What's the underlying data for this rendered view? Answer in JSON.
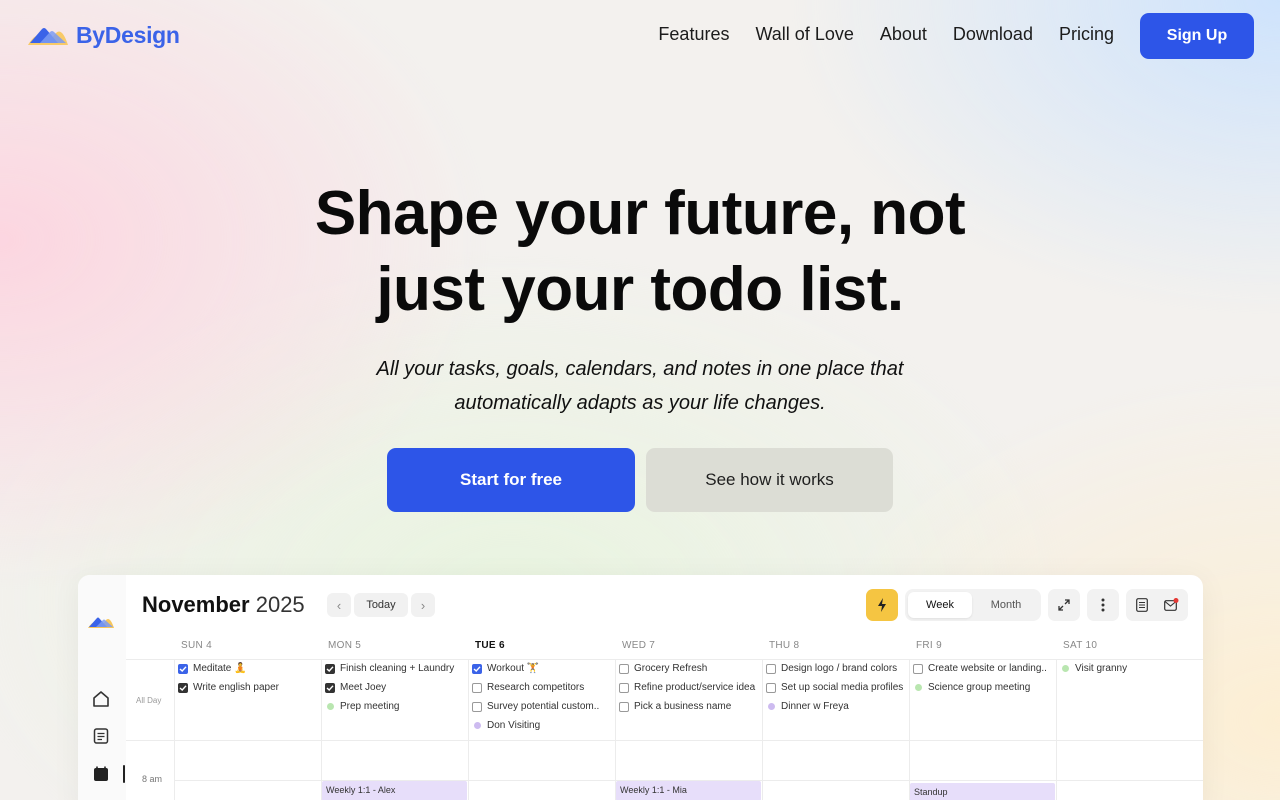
{
  "brand": {
    "name": "ByDesign",
    "color": "#3b63e8"
  },
  "nav": {
    "links": [
      "Features",
      "Wall of Love",
      "About",
      "Download",
      "Pricing"
    ],
    "signup": "Sign Up"
  },
  "hero": {
    "title_line1": "Shape your future, not",
    "title_line2": "just your todo list.",
    "subtitle_line1": "All your tasks, goals, calendars, and notes in one place that",
    "subtitle_line2": "automatically adapts as your life changes.",
    "cta_primary": "Start for free",
    "cta_secondary": "See how it works"
  },
  "app": {
    "month": "November",
    "year": "2025",
    "today_btn": "Today",
    "view_week": "Week",
    "view_month": "Month",
    "allday_label": "All Day",
    "time_label": "8 am",
    "days": [
      {
        "label": "SUN 4",
        "today": false
      },
      {
        "label": "MON 5",
        "today": false
      },
      {
        "label": "TUE 6",
        "today": true
      },
      {
        "label": "WED 7",
        "today": false
      },
      {
        "label": "THU 8",
        "today": false
      },
      {
        "label": "FRI 9",
        "today": false
      },
      {
        "label": "SAT 10",
        "today": false
      }
    ],
    "tasks": [
      [
        {
          "text": "Meditate 🧘",
          "kind": "blue"
        },
        {
          "text": "Write english paper",
          "kind": "checked"
        }
      ],
      [
        {
          "text": "Finish cleaning + Laundry",
          "kind": "checked"
        },
        {
          "text": "Meet Joey",
          "kind": "checked"
        },
        {
          "text": "Prep meeting",
          "kind": "dot-green"
        }
      ],
      [
        {
          "text": "Workout 🏋",
          "kind": "blue"
        },
        {
          "text": "Research competitors",
          "kind": "empty"
        },
        {
          "text": "Survey potential custom..",
          "kind": "empty"
        },
        {
          "text": "Don Visiting",
          "kind": "dot-purple"
        }
      ],
      [
        {
          "text": "Grocery Refresh",
          "kind": "empty"
        },
        {
          "text": "Refine product/service idea",
          "kind": "empty"
        },
        {
          "text": "Pick a business name",
          "kind": "empty"
        }
      ],
      [
        {
          "text": "Design logo / brand colors",
          "kind": "empty"
        },
        {
          "text": "Set up social media profiles",
          "kind": "empty"
        },
        {
          "text": "Dinner w Freya",
          "kind": "dot-purple"
        }
      ],
      [
        {
          "text": "Create website or landing..",
          "kind": "empty"
        },
        {
          "text": "Science group meeting",
          "kind": "dot-green"
        }
      ],
      [
        {
          "text": "Visit granny",
          "kind": "dot-green"
        }
      ]
    ],
    "events": [
      {
        "day": 1,
        "text": "Weekly 1:1 - Alex",
        "color": "#e7defa"
      },
      {
        "day": 3,
        "text": "Weekly 1:1 - Mia",
        "color": "#e7defa"
      },
      {
        "day": 5,
        "text": "Standup",
        "color": "#e7defa"
      }
    ],
    "colors": {
      "green_dot": "#b9e6b0",
      "purple_dot": "#cdbbf0",
      "accent": "#f5c542"
    }
  }
}
